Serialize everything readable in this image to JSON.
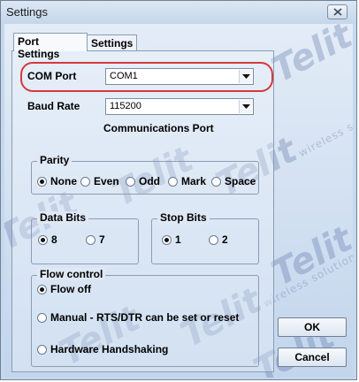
{
  "window": {
    "title": "Settings"
  },
  "tabs": [
    {
      "label": "Port Settings",
      "active": true
    },
    {
      "label": "Settings",
      "active": false
    }
  ],
  "com_port": {
    "label": "COM Port",
    "value": "COM1"
  },
  "baud_rate": {
    "label": "Baud Rate",
    "value": "115200"
  },
  "caption": "Communications Port",
  "parity": {
    "legend": "Parity",
    "options": [
      "None",
      "Even",
      "Odd",
      "Mark",
      "Space"
    ],
    "selected": "None"
  },
  "data_bits": {
    "legend": "Data Bits",
    "options": [
      "8",
      "7"
    ],
    "selected": "8"
  },
  "stop_bits": {
    "legend": "Stop Bits",
    "options": [
      "1",
      "2"
    ],
    "selected": "1"
  },
  "flow_control": {
    "legend": "Flow control",
    "options": [
      "Flow off",
      "Manual - RTS/DTR can be set or reset",
      "Hardware Handshaking"
    ],
    "selected": "Flow off"
  },
  "buttons": {
    "ok": "OK",
    "cancel": "Cancel"
  },
  "watermark": {
    "brand": "Telit",
    "tagline": "wireless solutions"
  },
  "colors": {
    "highlight": "#d43a3a",
    "background": "#c6d8ec"
  }
}
